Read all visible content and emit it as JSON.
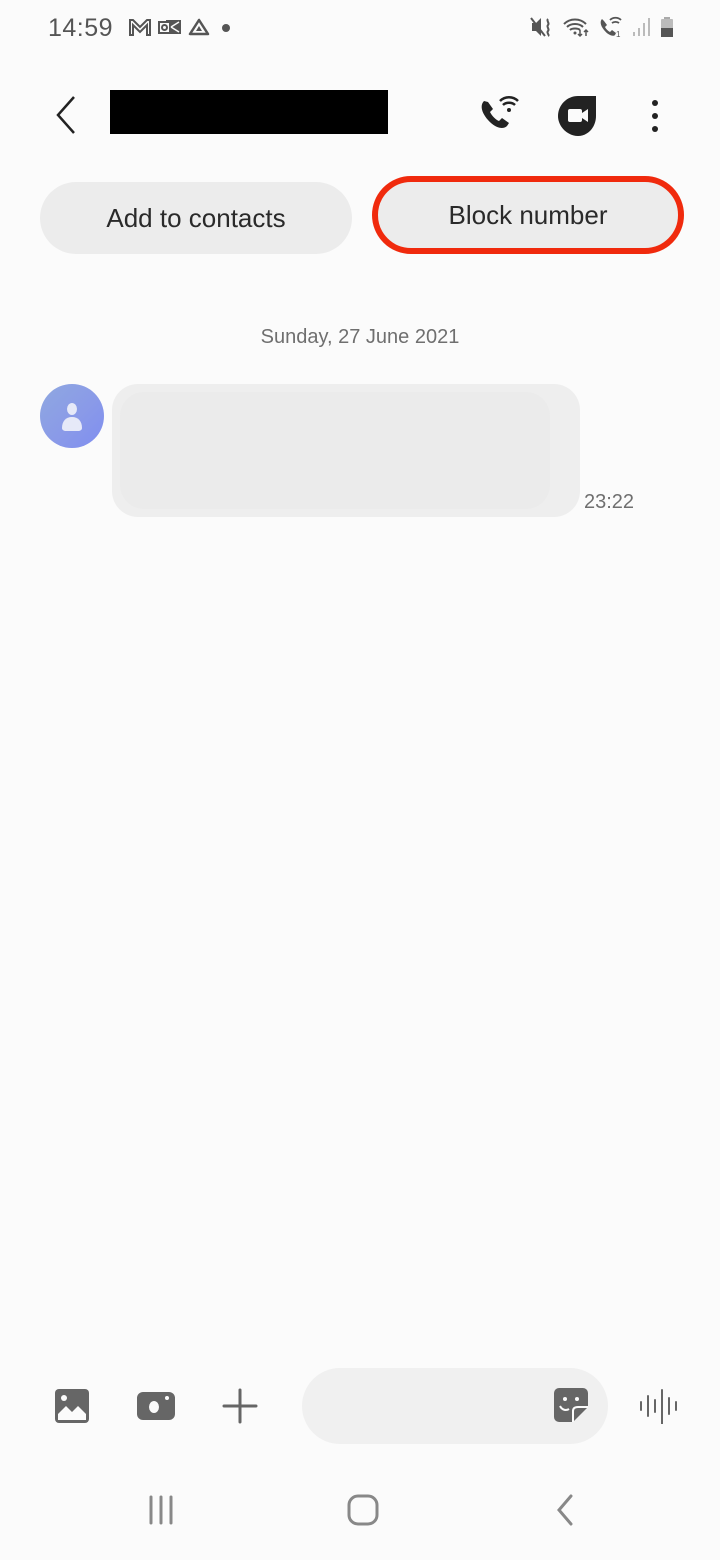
{
  "status_bar": {
    "time": "14:59",
    "left_icons": [
      "gmail-icon",
      "outlook-icon",
      "drive-icon",
      "notification-dot-icon"
    ],
    "right_icons": [
      "mute-vibrate-icon",
      "wifi-data-icon",
      "wifi-calling-icon",
      "signal-icon",
      "battery-icon"
    ],
    "wifi_calling_sim": "1"
  },
  "header": {
    "back_label": "Back",
    "contact_name": "[redacted]",
    "actions": [
      "wifi-call",
      "video-call",
      "more-options"
    ]
  },
  "actions": {
    "add_to_contacts": "Add to contacts",
    "block_number": "Block number",
    "highlight_color": "#f02a0d"
  },
  "conversation": {
    "date_separator": "Sunday, 27 June 2021",
    "messages": [
      {
        "direction": "incoming",
        "text": "",
        "time": "23:22"
      }
    ]
  },
  "composer": {
    "input_value": "",
    "input_placeholder": ""
  },
  "navbar": {
    "items": [
      "recents",
      "home",
      "back"
    ]
  }
}
